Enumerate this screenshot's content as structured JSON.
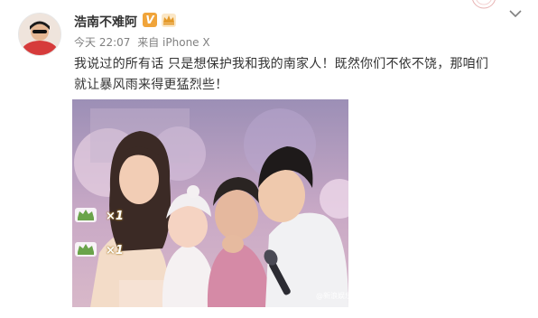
{
  "post": {
    "username": "浩南不难阿",
    "verified_badge": "V",
    "verified_color": "#f0a43a",
    "timestamp": "今天 22:07",
    "source": "来自 iPhone X",
    "text": "我说过的所有话 只是想保护我和我的南家人！既然你们不依不饶，那咱们就让暴风雨来得更猛烈些！",
    "gift_counts": [
      "×1",
      "×1"
    ],
    "photo_watermark": "@新浪娱乐"
  },
  "icons": {
    "avatar": "avatar",
    "member_crown": "crown-icon",
    "menu": "chevron-down-icon",
    "gift": "gift-icon"
  }
}
